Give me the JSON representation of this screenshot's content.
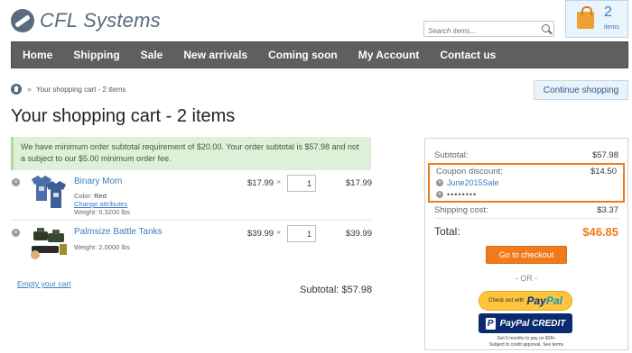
{
  "header": {
    "logo_text": "CFL Systems",
    "search": {
      "placeholder": "Search items..."
    },
    "cart": {
      "count": "2",
      "label": "items"
    }
  },
  "nav": {
    "items": [
      "Home",
      "Shipping",
      "Sale",
      "New arrivals",
      "Coming soon",
      "My Account",
      "Contact us"
    ]
  },
  "breadcrumb": {
    "sep": "»",
    "current": "Your shopping cart - 2 items"
  },
  "continue_button": "Continue shopping",
  "page_title": "Your shopping cart - 2 items",
  "notice": "We have minimum order subtotal requirement of $20.00. Your order subtotal is $57.98 and not a subject to our $5.00 minimum order fee.",
  "cart": {
    "items": [
      {
        "name": "Binary Mom",
        "color_label": "Color:",
        "color_value": "Red",
        "change_attrs": "Change attributes",
        "weight": "Weight: 0.3200 lbs",
        "price": "$17.99",
        "qty": "1",
        "total": "$17.99"
      },
      {
        "name": "Palmsize Battle Tanks",
        "weight": "Weight: 2.0000 lbs",
        "price": "$39.99",
        "qty": "1",
        "total": "$39.99"
      }
    ],
    "times": "×",
    "remove_glyph": "×",
    "empty_link": "Empty your cart",
    "subtotal": "Subtotal: $57.98"
  },
  "summary": {
    "subtotal_label": "Subtotal:",
    "subtotal_value": "$57.98",
    "coupon_label": "Coupon discount:",
    "coupon_value": "$14.50",
    "coupon_code": "June2015Sale",
    "coupon_mask": "••••••••",
    "shipping_label": "Shipping cost:",
    "shipping_value": "$3.37",
    "total_label": "Total:",
    "total_value": "$46.85",
    "checkout_button": "Go to checkout",
    "or_text": "- OR -",
    "paypal_prefix": "Check out with",
    "paypal_word_1": "Pay",
    "paypal_word_2": "Pal",
    "ppcredit_mark": "P",
    "ppcredit_label": "PayPal CREDIT",
    "ppcredit_note_1": "Get 6 months to pay on $99+",
    "ppcredit_note_2": "Subject to credit approval. See terms"
  },
  "colors": {
    "nav_bg": "#5f5f5f",
    "accent_orange": "#f07b1c",
    "link_blue": "#3a7cc0",
    "notice_bg": "#dff0d8"
  }
}
